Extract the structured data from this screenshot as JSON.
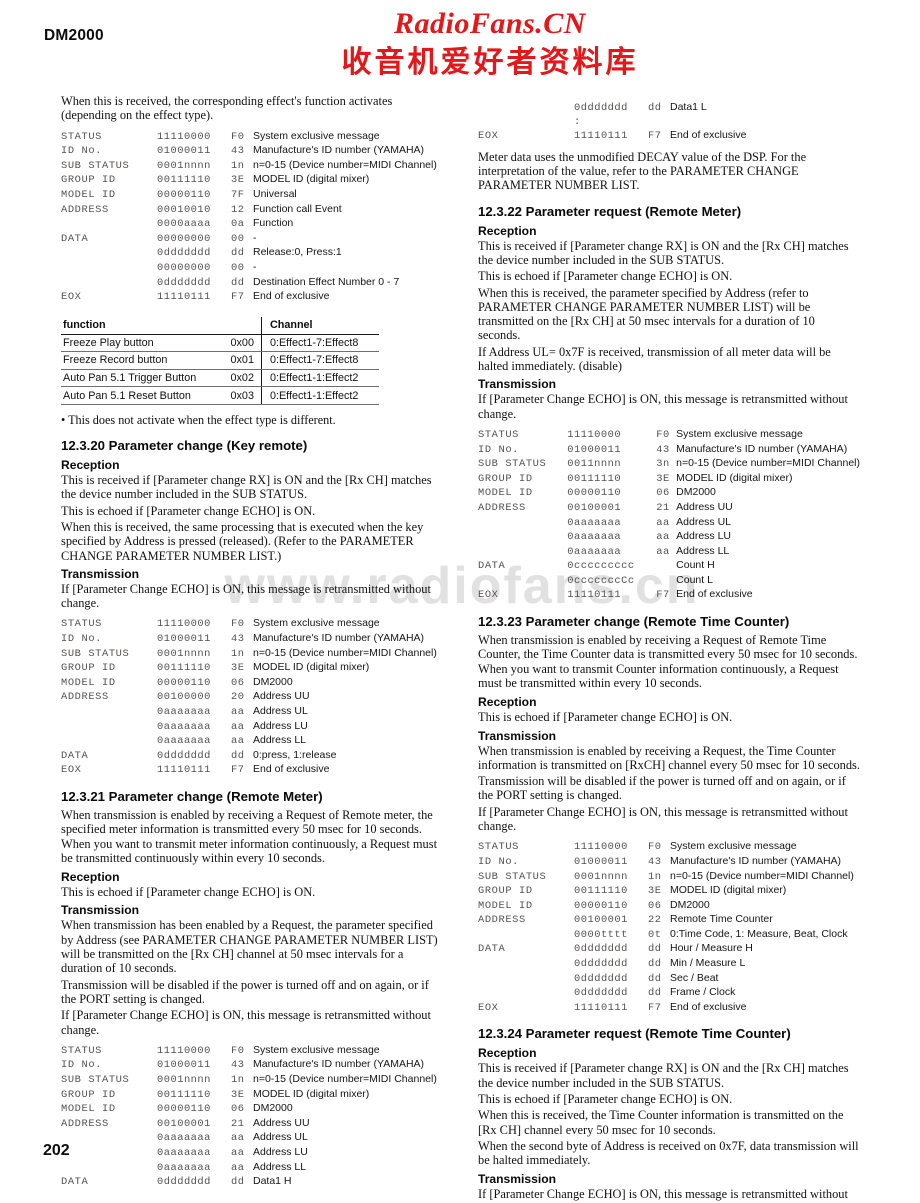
{
  "document": {
    "model": "DM2000",
    "page_number": "202"
  },
  "stamp": {
    "latin": "RadioFans.CN",
    "cjk": "收音机爱好者资料库",
    "color": "#e2181b"
  },
  "watermark": {
    "text": "www.radiofans.cn"
  },
  "left_column": {
    "intro": "When this is received, the corresponding effect's function activates (depending on the effect type).",
    "table_function_call": {
      "rows": [
        {
          "label": "STATUS",
          "bits": "11110000",
          "hex": "F0",
          "desc": "System exclusive message"
        },
        {
          "label": "ID No.",
          "bits": "01000011",
          "hex": "43",
          "desc": "Manufacture's ID number (YAMAHA)"
        },
        {
          "label": "SUB STATUS",
          "bits": "0001nnnn",
          "hex": "1n",
          "desc": "n=0-15 (Device number=MIDI Channel)"
        },
        {
          "label": "GROUP ID",
          "bits": "00111110",
          "hex": "3E",
          "desc": "MODEL ID (digital mixer)"
        },
        {
          "label": "MODEL ID",
          "bits": "00000110",
          "hex": "7F",
          "desc": "Universal"
        },
        {
          "label": "ADDRESS",
          "bits": "00010010",
          "hex": "12",
          "desc": "Function call Event"
        },
        {
          "label": "",
          "bits": "0000aaaa",
          "hex": "0a",
          "desc": "Function"
        },
        {
          "label": "DATA",
          "bits": "00000000",
          "hex": "00",
          "desc": "-"
        },
        {
          "label": "",
          "bits": "0ddddddd",
          "hex": "dd",
          "desc": "Release:0, Press:1"
        },
        {
          "label": "",
          "bits": "00000000",
          "hex": "00",
          "desc": "-"
        },
        {
          "label": "",
          "bits": "0ddddddd",
          "hex": "dd",
          "desc": "Destination Effect Number 0 - 7"
        },
        {
          "label": "EOX",
          "bits": "11110111",
          "hex": "F7",
          "desc": "End of exclusive"
        }
      ]
    },
    "function_table": {
      "headers": {
        "function": "function",
        "channel": "Channel"
      },
      "rows": [
        {
          "function": "Freeze Play button",
          "addr": "0x00",
          "channel": "0:Effect1-7:Effect8"
        },
        {
          "function": "Freeze Record button",
          "addr": "0x01",
          "channel": "0:Effect1-7:Effect8"
        },
        {
          "function": "Auto Pan 5.1 Trigger Button",
          "addr": "0x02",
          "channel": "0:Effect1-1:Effect2"
        },
        {
          "function": "Auto Pan 5.1 Reset Button",
          "addr": "0x03",
          "channel": "0:Effect1-1:Effect2"
        }
      ]
    },
    "note": "• This does not activate when the effect type is different.",
    "section_12_3_20": {
      "heading": "12.3.20 Parameter change (Key remote)",
      "reception_head": "Reception",
      "reception_paras": [
        "This is received if [Parameter change RX] is ON and the [Rx CH] matches the device number included in the SUB STATUS.",
        "This is echoed if [Parameter change ECHO] is ON.",
        "When this is received, the same processing that is executed when the key specified by Address is pressed (released). (Refer to the PARAMETER CHANGE PARAMETER NUMBER LIST.)"
      ],
      "transmission_head": "Transmission",
      "transmission_paras": [
        "If [Parameter Change ECHO] is ON, this message is retransmitted without change."
      ],
      "table": {
        "rows": [
          {
            "label": "STATUS",
            "bits": "11110000",
            "hex": "F0",
            "desc": "System exclusive message"
          },
          {
            "label": "ID No.",
            "bits": "01000011",
            "hex": "43",
            "desc": "Manufacture's ID number (YAMAHA)"
          },
          {
            "label": "SUB STATUS",
            "bits": "0001nnnn",
            "hex": "1n",
            "desc": "n=0-15 (Device number=MIDI Channel)"
          },
          {
            "label": "GROUP ID",
            "bits": "00111110",
            "hex": "3E",
            "desc": "MODEL ID (digital mixer)"
          },
          {
            "label": "MODEL ID",
            "bits": "00000110",
            "hex": "06",
            "desc": "DM2000"
          },
          {
            "label": "ADDRESS",
            "bits": "00100000",
            "hex": "20",
            "desc": "Address UU"
          },
          {
            "label": "",
            "bits": "0aaaaaaa",
            "hex": "aa",
            "desc": "Address UL"
          },
          {
            "label": "",
            "bits": "0aaaaaaa",
            "hex": "aa",
            "desc": "Address LU"
          },
          {
            "label": "",
            "bits": "0aaaaaaa",
            "hex": "aa",
            "desc": "Address LL"
          },
          {
            "label": "DATA",
            "bits": "0ddddddd",
            "hex": "dd",
            "desc": "0:press, 1:release"
          },
          {
            "label": "EOX",
            "bits": "11110111",
            "hex": "F7",
            "desc": "End of exclusive"
          }
        ]
      }
    },
    "section_12_3_21": {
      "heading": "12.3.21 Parameter change (Remote Meter)",
      "intro_paras": [
        "When transmission is enabled by receiving a Request of Remote meter, the specified meter information is transmitted every 50 msec for 10 seconds. When you want to transmit meter information continuously, a Request must be transmitted continuously within every 10 seconds."
      ],
      "reception_head": "Reception",
      "reception_paras": [
        "This is echoed if [Parameter change ECHO] is ON."
      ],
      "transmission_head": "Transmission",
      "transmission_paras": [
        "When transmission has been enabled by a Request, the parameter specified by Address (see PARAMETER CHANGE PARAMETER NUMBER LIST) will be transmitted on the [Rx CH] channel at 50 msec intervals for a duration of 10 seconds.",
        "Transmission will be disabled if the power is turned off and on again, or if the PORT setting is changed.",
        "If [Parameter Change ECHO] is ON, this message is retransmitted without change."
      ],
      "table": {
        "rows": [
          {
            "label": "STATUS",
            "bits": "11110000",
            "hex": "F0",
            "desc": "System exclusive message"
          },
          {
            "label": "ID No.",
            "bits": "01000011",
            "hex": "43",
            "desc": "Manufacture's ID number (YAMAHA)"
          },
          {
            "label": "SUB STATUS",
            "bits": "0001nnnn",
            "hex": "1n",
            "desc": "n=0-15 (Device number=MIDI Channel)"
          },
          {
            "label": "GROUP ID",
            "bits": "00111110",
            "hex": "3E",
            "desc": "MODEL ID (digital mixer)"
          },
          {
            "label": "MODEL ID",
            "bits": "00000110",
            "hex": "06",
            "desc": "DM2000"
          },
          {
            "label": "ADDRESS",
            "bits": "00100001",
            "hex": "21",
            "desc": "Address UU"
          },
          {
            "label": "",
            "bits": "0aaaaaaa",
            "hex": "aa",
            "desc": "Address UL"
          },
          {
            "label": "",
            "bits": "0aaaaaaa",
            "hex": "aa",
            "desc": "Address LU"
          },
          {
            "label": "",
            "bits": "0aaaaaaa",
            "hex": "aa",
            "desc": "Address LL"
          },
          {
            "label": "DATA",
            "bits": "0ddddddd",
            "hex": "dd",
            "desc": "Data1 H"
          }
        ]
      }
    }
  },
  "right_column": {
    "table_continued": {
      "rows": [
        {
          "label": "",
          "bits": "0ddddddd",
          "hex": "dd",
          "desc": "Data1 L"
        },
        {
          "label": "",
          "bits": ":",
          "hex": "",
          "desc": ""
        },
        {
          "label": "EOX",
          "bits": "11110111",
          "hex": "F7",
          "desc": "End of exclusive"
        }
      ]
    },
    "meter_note": "Meter data uses the unmodified DECAY value of the DSP. For the interpretation of the value, refer to the PARAMETER CHANGE PARAMETER NUMBER LIST.",
    "section_12_3_22": {
      "heading": "12.3.22 Parameter request (Remote Meter)",
      "reception_head": "Reception",
      "reception_paras": [
        "This is received if [Parameter change RX] is ON and the [Rx CH] matches the device number included in the SUB STATUS.",
        "This is echoed if [Parameter change ECHO] is ON.",
        "When this is received, the parameter specified by Address (refer to PARAMETER CHANGE PARAMETER NUMBER LIST) will be transmitted on the [Rx CH] at 50 msec intervals for a duration of 10 seconds.",
        "If Address UL= 0x7F is received, transmission of all meter data will be halted immediately. (disable)"
      ],
      "transmission_head": "Transmission",
      "transmission_paras": [
        "If [Parameter Change ECHO] is ON, this message is retransmitted without change."
      ],
      "table": {
        "rows": [
          {
            "label": "STATUS",
            "bits": "11110000",
            "hex": "F0",
            "desc": "System exclusive message"
          },
          {
            "label": "ID No.",
            "bits": "01000011",
            "hex": "43",
            "desc": "Manufacture's ID number (YAMAHA)"
          },
          {
            "label": "SUB STATUS",
            "bits": "0011nnnn",
            "hex": "3n",
            "desc": "n=0-15 (Device number=MIDI Channel)"
          },
          {
            "label": "GROUP ID",
            "bits": "00111110",
            "hex": "3E",
            "desc": "MODEL ID (digital mixer)"
          },
          {
            "label": "MODEL ID",
            "bits": "00000110",
            "hex": "06",
            "desc": "DM2000"
          },
          {
            "label": "ADDRESS",
            "bits": "00100001",
            "hex": "21",
            "desc": "Address UU"
          },
          {
            "label": "",
            "bits": "0aaaaaaa",
            "hex": "aa",
            "desc": "Address UL"
          },
          {
            "label": "",
            "bits": "0aaaaaaa",
            "hex": "aa",
            "desc": "Address LU"
          },
          {
            "label": "",
            "bits": "0aaaaaaa",
            "hex": "aa",
            "desc": "Address LL"
          },
          {
            "label": "DATA",
            "bits": "0ccccccccc",
            "hex": "",
            "desc": "Count H"
          },
          {
            "label": "",
            "bits": "0cccccccCc",
            "hex": "",
            "desc": "Count L"
          },
          {
            "label": "EOX",
            "bits": "11110111",
            "hex": "F7",
            "desc": "End of exclusive"
          }
        ]
      }
    },
    "section_12_3_23": {
      "heading": "12.3.23 Parameter change (Remote Time Counter)",
      "intro_paras": [
        "When transmission is enabled by receiving a Request of Remote Time Counter, the Time Counter data is transmitted every 50 msec for 10 seconds. When you want to transmit Counter information continuously, a Request must be transmitted within every 10 seconds."
      ],
      "reception_head": "Reception",
      "reception_paras": [
        "This is echoed if [Parameter change ECHO] is ON."
      ],
      "transmission_head": "Transmission",
      "transmission_paras": [
        "When transmission is enabled by receiving a Request, the Time Counter information is transmitted on [RxCH] channel every 50 msec for 10 seconds.",
        "Transmission will be disabled if the power is turned off and on again, or if the PORT setting is changed.",
        "If [Parameter Change ECHO] is ON, this message is retransmitted without change."
      ],
      "table": {
        "rows": [
          {
            "label": "STATUS",
            "bits": "11110000",
            "hex": "F0",
            "desc": "System exclusive message"
          },
          {
            "label": "ID No.",
            "bits": "01000011",
            "hex": "43",
            "desc": "Manufacture's ID number (YAMAHA)"
          },
          {
            "label": "SUB STATUS",
            "bits": "0001nnnn",
            "hex": "1n",
            "desc": "n=0-15 (Device number=MIDI Channel)"
          },
          {
            "label": "GROUP ID",
            "bits": "00111110",
            "hex": "3E",
            "desc": "MODEL ID (digital mixer)"
          },
          {
            "label": "MODEL ID",
            "bits": "00000110",
            "hex": "06",
            "desc": "DM2000"
          },
          {
            "label": "ADDRESS",
            "bits": "00100001",
            "hex": "22",
            "desc": "Remote Time Counter"
          },
          {
            "label": "",
            "bits": "0000tttt",
            "hex": "0t",
            "desc": "0:Time Code, 1: Measure, Beat, Clock"
          },
          {
            "label": "DATA",
            "bits": "0ddddddd",
            "hex": "dd",
            "desc": "Hour / Measure H"
          },
          {
            "label": "",
            "bits": "0ddddddd",
            "hex": "dd",
            "desc": "Min / Measure L"
          },
          {
            "label": "",
            "bits": "0ddddddd",
            "hex": "dd",
            "desc": "Sec / Beat"
          },
          {
            "label": "",
            "bits": "0ddddddd",
            "hex": "dd",
            "desc": "Frame / Clock"
          },
          {
            "label": "EOX",
            "bits": "11110111",
            "hex": "F7",
            "desc": "End of exclusive"
          }
        ]
      }
    },
    "section_12_3_24": {
      "heading": "12.3.24 Parameter request (Remote Time Counter)",
      "reception_head": "Reception",
      "reception_paras": [
        "This is received if [Parameter change RX] is ON and the [Rx CH] matches the device number included in the SUB STATUS.",
        "This is echoed if [Parameter change ECHO] is ON.",
        "When this is received, the Time Counter information is transmitted on the [Rx CH] channel every 50 msec for 10 seconds.",
        "When the second byte of Address is received on 0x7F, data transmission will be halted immediately."
      ],
      "transmission_head": "Transmission",
      "transmission_paras": [
        "If [Parameter Change ECHO] is ON, this message is retransmitted without"
      ]
    }
  }
}
